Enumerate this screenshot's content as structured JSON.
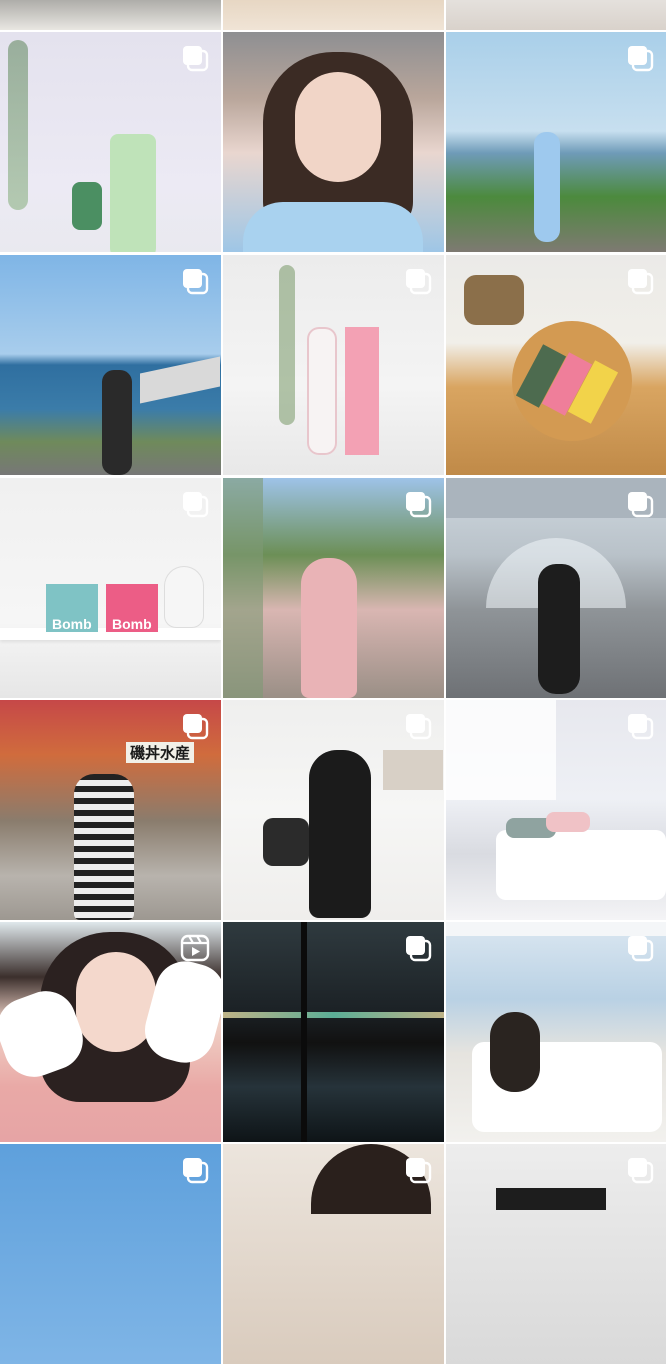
{
  "screen": {
    "type": "photo-grid",
    "columns": 3,
    "background": "#ffffff"
  },
  "tiles": [
    {
      "row": 0,
      "col": 0,
      "theme": "top-dark",
      "badge": "carousel-icon"
    },
    {
      "row": 0,
      "col": 1,
      "theme": "top-beige",
      "badge": "carousel-icon"
    },
    {
      "row": 0,
      "col": 2,
      "theme": "top-white",
      "badge": "carousel-icon"
    },
    {
      "row": 1,
      "col": 0,
      "theme": "product-green",
      "badge": "carousel-icon"
    },
    {
      "row": 1,
      "col": 1,
      "theme": "portrait-blue",
      "badge": "none"
    },
    {
      "row": 1,
      "col": 2,
      "theme": "sea-coast",
      "badge": "carousel-icon"
    },
    {
      "row": 2,
      "col": 0,
      "theme": "sea-rail",
      "badge": "carousel-icon"
    },
    {
      "row": 2,
      "col": 1,
      "theme": "product-pink",
      "badge": "carousel-icon"
    },
    {
      "row": 2,
      "col": 2,
      "theme": "tray-boxes",
      "badge": "carousel-icon"
    },
    {
      "row": 3,
      "col": 0,
      "theme": "shelf-bomb",
      "badge": "carousel-icon",
      "brand": "Bomb"
    },
    {
      "row": 3,
      "col": 1,
      "theme": "street-pink",
      "badge": "carousel-icon"
    },
    {
      "row": 3,
      "col": 2,
      "theme": "street-umbrella",
      "badge": "carousel-icon"
    },
    {
      "row": 4,
      "col": 0,
      "theme": "market-street",
      "badge": "carousel-icon",
      "sign": "磯丼水産"
    },
    {
      "row": 4,
      "col": 1,
      "theme": "room-black",
      "badge": "carousel-icon"
    },
    {
      "row": 4,
      "col": 2,
      "theme": "bedroom",
      "badge": "carousel-icon"
    },
    {
      "row": 5,
      "col": 0,
      "theme": "selfie-pink",
      "badge": "reels-icon"
    },
    {
      "row": 5,
      "col": 1,
      "theme": "night-window",
      "badge": "carousel-icon"
    },
    {
      "row": 5,
      "col": 2,
      "theme": "window-bed",
      "badge": "carousel-icon"
    },
    {
      "row": 6,
      "col": 0,
      "theme": "bottom-sky",
      "badge": "carousel-icon"
    },
    {
      "row": 6,
      "col": 1,
      "theme": "bottom-face",
      "badge": "carousel-icon"
    },
    {
      "row": 6,
      "col": 2,
      "theme": "bottom-room",
      "badge": "carousel-icon"
    }
  ]
}
